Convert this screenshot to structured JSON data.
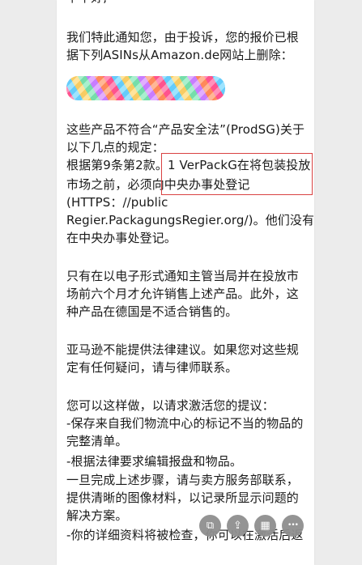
{
  "email": {
    "line_0": "下午好,",
    "line_1": "我们特此通知您，由于投诉，您的报价已根",
    "line_2": "据下列ASINs从Amazon.de网站上删除：",
    "line_3": "这些产品不符合“产品安全法”(ProdSG)关于",
    "line_4": "以下几点的规定：",
    "line_5": " 根据第9条第2款。1 VerPackG在将包装投放",
    "line_6": "市场之前，必须向中央办事处登记",
    "line_7": "(HTTPS：//public",
    "line_8": "Regier.PackagungsRegier.org/)。他们没有",
    "line_9": "在中央办事处登记。",
    "line_10": "只有在以电子形式通知主管当局并在投放市",
    "line_11": "场前六个月才允许销售上述产品。此外，这",
    "line_12": "种产品在德国是不适合销售的。",
    "line_13": "亚马逊不能提供法律建议。如果您对这些规",
    "line_14": "定有任何疑问，请与律师联系。",
    "line_15": "您可以这样做，以请求激活您的提议：",
    "line_16": "-保存来自我们物流中心的标记不当的物品的",
    "line_17": "完整清单。",
    "line_18": "-根据法律要求编辑报盘和物品。",
    "line_19": "一旦完成上述步骤，请与卖方服务部联系，",
    "line_20": "提供清晰的图像材料，以记录所显示问题的",
    "line_21": "解决方案。",
    "line_22": "-你的详细资料将被检查，你可以在激活后返"
  },
  "toolbar": {
    "buttons": [
      {
        "icon": "copy-icon",
        "glyph": "⧉"
      },
      {
        "icon": "share-icon",
        "glyph": "⇪"
      },
      {
        "icon": "grid-icon",
        "glyph": "▦"
      },
      {
        "icon": "more-icon",
        "glyph": "•••"
      }
    ]
  },
  "colors": {
    "highlight_border": "#d94242",
    "fab_background": "#8f8f8f"
  }
}
